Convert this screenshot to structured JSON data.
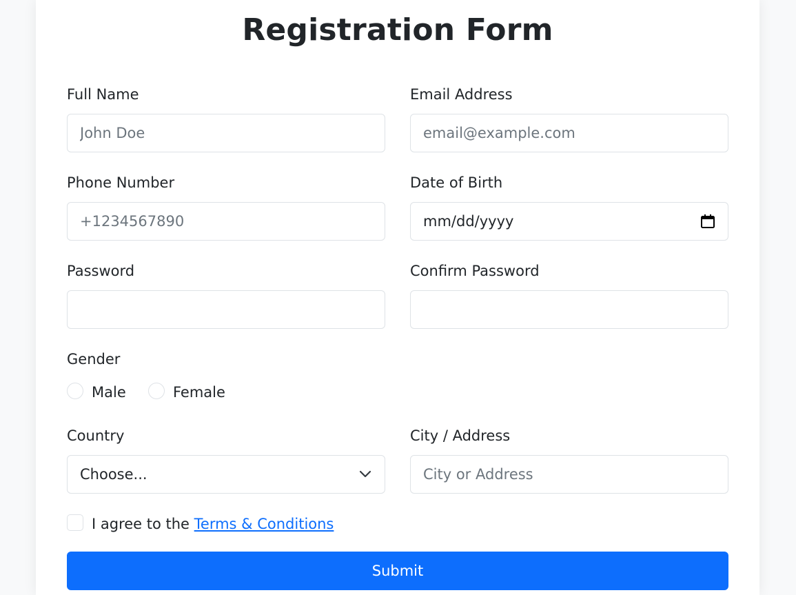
{
  "form": {
    "title": "Registration Form",
    "full_name": {
      "label": "Full Name",
      "placeholder": "John Doe"
    },
    "email": {
      "label": "Email Address",
      "placeholder": "email@example.com"
    },
    "phone": {
      "label": "Phone Number",
      "placeholder": "+1234567890"
    },
    "dob": {
      "label": "Date of Birth",
      "value": "mm/dd/yyyy",
      "icon": "calendar-icon"
    },
    "password": {
      "label": "Password"
    },
    "confirm_password": {
      "label": "Confirm Password"
    },
    "gender": {
      "label": "Gender",
      "options": [
        "Male",
        "Female"
      ]
    },
    "country": {
      "label": "Country",
      "selected": "Choose...",
      "icon": "chevron-down-icon"
    },
    "city": {
      "label": "City / Address",
      "placeholder": "City or Address"
    },
    "terms": {
      "prefix": "I agree to the ",
      "link": "Terms & Conditions"
    },
    "submit_label": "Submit"
  },
  "colors": {
    "primary": "#0d6efd",
    "border": "#dee2e6",
    "placeholder": "#6c757d",
    "text": "#212529",
    "background": "#f8f9fa"
  }
}
